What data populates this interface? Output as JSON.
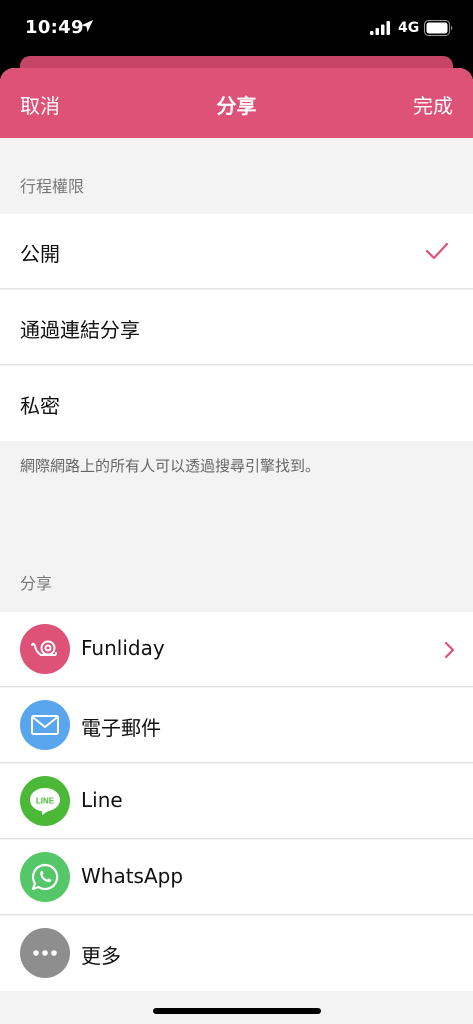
{
  "status_bar": {
    "time": "10:49",
    "network": "4G"
  },
  "nav": {
    "cancel_label": "取消",
    "title": "分享",
    "done_label": "完成"
  },
  "privacy": {
    "header": "行程權限",
    "options": [
      {
        "label": "公開",
        "selected": true
      },
      {
        "label": "通過連結分享",
        "selected": false
      },
      {
        "label": "私密",
        "selected": false
      }
    ],
    "footer": "網際網路上的所有人可以透過搜尋引擎找到。"
  },
  "share": {
    "header": "分享",
    "items": [
      {
        "label": "Funliday",
        "icon": "funliday-snail-icon",
        "color": "#de5278",
        "chevron": true
      },
      {
        "label": "電子郵件",
        "icon": "mail-icon",
        "color": "#5aa6ee",
        "chevron": false
      },
      {
        "label": "Line",
        "icon": "line-icon",
        "color": "#4cb838",
        "chevron": false
      },
      {
        "label": "WhatsApp",
        "icon": "whatsapp-icon",
        "color": "#56c769",
        "chevron": false
      },
      {
        "label": "更多",
        "icon": "more-icon",
        "color": "#8e8e8e",
        "chevron": false
      }
    ]
  },
  "colors": {
    "accent": "#de5278",
    "background": "#f3f3f3"
  }
}
